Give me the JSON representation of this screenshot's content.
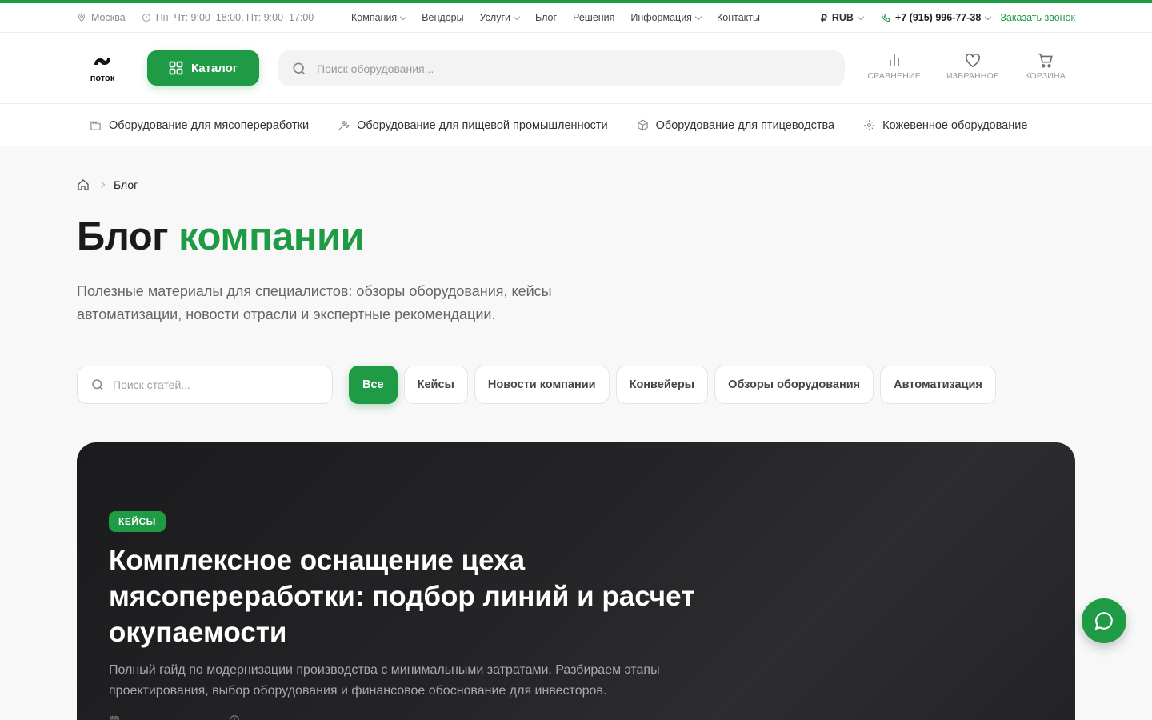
{
  "topbar": {
    "city": "Москва",
    "hours": "Пн–Чт: 9:00–18:00, Пт: 9:00–17:00",
    "nav": [
      {
        "label": "Компания",
        "dropdown": true
      },
      {
        "label": "Вендоры",
        "dropdown": false
      },
      {
        "label": "Услуги",
        "dropdown": true
      },
      {
        "label": "Блог",
        "dropdown": false
      },
      {
        "label": "Решения",
        "dropdown": false
      },
      {
        "label": "Информация",
        "dropdown": true
      },
      {
        "label": "Контакты",
        "dropdown": false
      }
    ],
    "currency": "RUB",
    "currency_symbol": "₽",
    "phone": "+7 (915) 996-77-38",
    "callback": "Заказать звонок"
  },
  "header": {
    "logo_text": "поток",
    "catalog_label": "Каталог",
    "search_placeholder": "Поиск оборудования...",
    "compare_label": "СРАВНЕНИЕ",
    "favorites_label": "ИЗБРАННОЕ",
    "cart_label": "КОРЗИНА"
  },
  "categories": [
    {
      "label": "Оборудование для мясопереработки",
      "icon": "factory-icon"
    },
    {
      "label": "Оборудование для пищевой промышленности",
      "icon": "wheat-icon"
    },
    {
      "label": "Оборудование для птицеводства",
      "icon": "box-icon"
    },
    {
      "label": "Кожевенное оборудование",
      "icon": "gear-icon"
    }
  ],
  "breadcrumb": {
    "current": "Блог"
  },
  "page": {
    "title_main": "Блог",
    "title_accent": "компании",
    "subtitle": "Полезные материалы для специалистов: обзоры оборудования, кейсы автоматизации, новости отрасли и экспертные рекомендации."
  },
  "filters": {
    "search_placeholder": "Поиск статей...",
    "chips": [
      "Все",
      "Кейсы",
      "Новости компании",
      "Конвейеры",
      "Обзоры оборудования",
      "Автоматизация"
    ],
    "active": "Все"
  },
  "featured": {
    "badge": "КЕЙСЫ",
    "title": "Комплексное оснащение цеха мясопереработки: подбор линий и расчет окупаемости",
    "excerpt": "Полный гайд по модернизации производства с минимальными затратами. Разбираем этапы проектирования, выбор оборудования и финансовое обоснование для инвесторов."
  },
  "colors": {
    "accent": "#1f9a45",
    "hero_bg": "#1f1f21"
  }
}
